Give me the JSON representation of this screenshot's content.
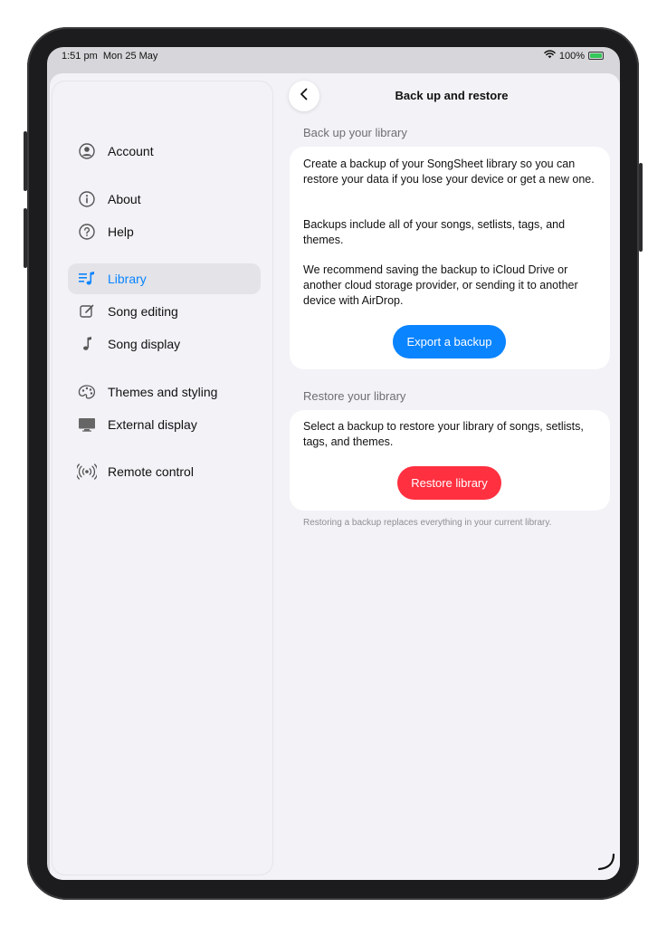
{
  "status_bar": {
    "time": "1:51 pm",
    "date": "Mon 25 May",
    "battery": "100%",
    "battery_level": 1.0,
    "icons": [
      "wifi-icon",
      "battery-charging-icon"
    ]
  },
  "sidebar": {
    "items": [
      {
        "label": "Account",
        "icon": "person-circle-icon"
      },
      {
        "label": "About",
        "icon": "info-circle-icon"
      },
      {
        "label": "Help",
        "icon": "question-circle-icon"
      },
      {
        "label": "Library",
        "icon": "music-list-icon",
        "active": true
      },
      {
        "label": "Song editing",
        "icon": "pencil-square-icon"
      },
      {
        "label": "Song display",
        "icon": "music-note-icon"
      },
      {
        "label": "Themes and styling",
        "icon": "palette-icon"
      },
      {
        "label": "External display",
        "icon": "monitor-icon"
      },
      {
        "label": "Remote control",
        "icon": "broadcast-icon"
      }
    ]
  },
  "detail": {
    "back_icon": "chevron-left-icon",
    "title": "Back up and restore",
    "backup_section": {
      "header": "Back up your library",
      "paragraphs": [
        "Create a backup of your SongSheet library so you can restore your data if you lose your device or get a new one.",
        "Backups include all of your songs, setlists, tags, and themes.",
        "We recommend saving the backup to iCloud Drive or another cloud storage provider, or sending it to another device with AirDrop."
      ],
      "button_label": "Export a backup"
    },
    "restore_section": {
      "header": "Restore your library",
      "paragraph": "Select a backup to restore your library of songs, setlists, tags, and themes.",
      "button_label": "Restore library",
      "footer": "Restoring a backup replaces everything in your current library."
    }
  },
  "colors": {
    "accent": "#0a84ff",
    "destructive": "#ff3040",
    "background": "#f2f2f7",
    "card": "#ffffff",
    "secondary_text": "#6e6e73"
  }
}
